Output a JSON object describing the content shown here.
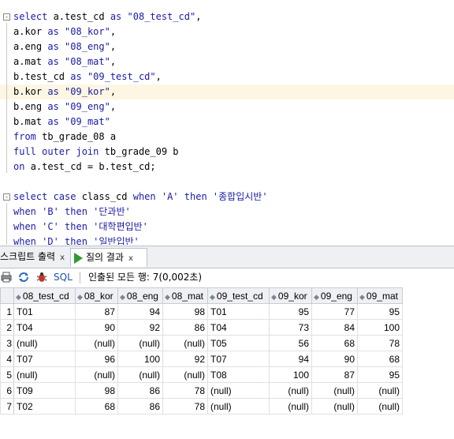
{
  "editor": {
    "lines": [
      {
        "fold": "-",
        "parts": [
          [
            "kw",
            "select "
          ],
          [
            "",
            "a.test_cd "
          ],
          [
            "kw",
            "as "
          ],
          [
            "str",
            "\"08_test_cd\""
          ],
          [
            "",
            ","
          ]
        ]
      },
      {
        "parts": [
          [
            "",
            "a.kor "
          ],
          [
            "kw",
            "as "
          ],
          [
            "str",
            "\"08_kor\""
          ],
          [
            "",
            ","
          ]
        ]
      },
      {
        "parts": [
          [
            "",
            "a.eng "
          ],
          [
            "kw",
            "as "
          ],
          [
            "str",
            "\"08_eng\""
          ],
          [
            "",
            ","
          ]
        ]
      },
      {
        "parts": [
          [
            "",
            "a.mat "
          ],
          [
            "kw",
            "as "
          ],
          [
            "str",
            "\"08_mat\""
          ],
          [
            "",
            ","
          ]
        ]
      },
      {
        "parts": [
          [
            "",
            "b.test_cd "
          ],
          [
            "kw",
            "as "
          ],
          [
            "str",
            "\"09_test_cd\""
          ],
          [
            "",
            ","
          ]
        ]
      },
      {
        "hl": true,
        "parts": [
          [
            "",
            "b.kor "
          ],
          [
            "kw",
            "as "
          ],
          [
            "str",
            "\"09_kor\""
          ],
          [
            "",
            ","
          ]
        ]
      },
      {
        "parts": [
          [
            "",
            "b.eng "
          ],
          [
            "kw",
            "as "
          ],
          [
            "str",
            "\"09_eng\""
          ],
          [
            "",
            ","
          ]
        ]
      },
      {
        "parts": [
          [
            "",
            "b.mat "
          ],
          [
            "kw",
            "as "
          ],
          [
            "str",
            "\"09_mat\""
          ]
        ]
      },
      {
        "parts": [
          [
            "kw",
            "from "
          ],
          [
            "",
            "tb_grade_08 a"
          ]
        ]
      },
      {
        "parts": [
          [
            "kw",
            "full outer join "
          ],
          [
            "",
            "tb_grade_09 b"
          ]
        ]
      },
      {
        "parts": [
          [
            "kw",
            "on "
          ],
          [
            "",
            "a.test_cd = b.test_cd;"
          ]
        ]
      },
      {
        "parts": []
      },
      {
        "fold": "-",
        "parts": [
          [
            "kw",
            "select case "
          ],
          [
            "",
            "class_cd "
          ],
          [
            "kw",
            "when "
          ],
          [
            "str",
            "'A' "
          ],
          [
            "kw",
            "then "
          ],
          [
            "str",
            "'종합입시반'"
          ]
        ]
      },
      {
        "parts": [
          [
            "kw",
            "when "
          ],
          [
            "str",
            "'B' "
          ],
          [
            "kw",
            "then "
          ],
          [
            "str",
            "'단과반'"
          ]
        ]
      },
      {
        "parts": [
          [
            "kw",
            "when "
          ],
          [
            "str",
            "'C' "
          ],
          [
            "kw",
            "then "
          ],
          [
            "str",
            "'대학편입반'"
          ]
        ]
      },
      {
        "parts": [
          [
            "kw",
            "when "
          ],
          [
            "str",
            "'D' "
          ],
          [
            "kw",
            "then "
          ],
          [
            "str",
            "'일반입반'"
          ]
        ]
      }
    ]
  },
  "tabs": [
    {
      "label": "스크립트 출력",
      "close": "x",
      "active": false
    },
    {
      "label": "질의 결과",
      "close": "x",
      "active": true
    }
  ],
  "toolbar": {
    "sql_label": "SQL",
    "status": "인출된 모든 행: 7(0,002초)"
  },
  "grid": {
    "columns": [
      "08_test_cd",
      "08_kor",
      "08_eng",
      "08_mat",
      "09_test_cd",
      "09_kor",
      "09_eng",
      "09_mat"
    ],
    "rows": [
      [
        "1",
        "T01",
        "87",
        "94",
        "98",
        "T01",
        "95",
        "77",
        "95"
      ],
      [
        "2",
        "T04",
        "90",
        "92",
        "86",
        "T04",
        "73",
        "84",
        "100"
      ],
      [
        "3",
        "(null)",
        "(null)",
        "(null)",
        "(null)",
        "T05",
        "56",
        "68",
        "78"
      ],
      [
        "4",
        "T07",
        "96",
        "100",
        "92",
        "T07",
        "94",
        "90",
        "68"
      ],
      [
        "5",
        "(null)",
        "(null)",
        "(null)",
        "(null)",
        "T08",
        "100",
        "87",
        "95"
      ],
      [
        "6",
        "T09",
        "98",
        "86",
        "78",
        "(null)",
        "(null)",
        "(null)",
        "(null)"
      ],
      [
        "7",
        "T02",
        "68",
        "86",
        "78",
        "(null)",
        "(null)",
        "(null)",
        "(null)"
      ]
    ]
  }
}
